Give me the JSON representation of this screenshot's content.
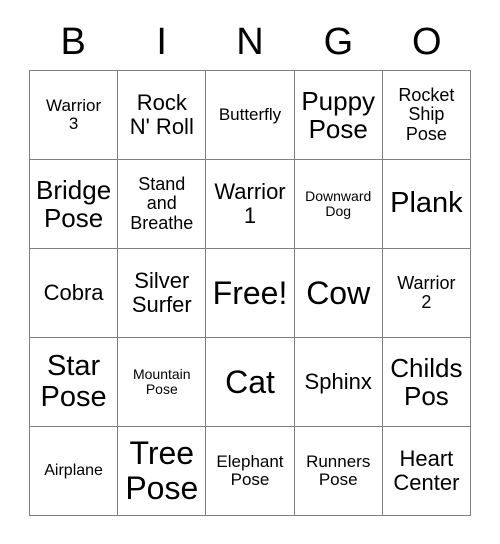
{
  "card": {
    "title": "BINGO",
    "header_letters": [
      "B",
      "I",
      "N",
      "G",
      "O"
    ],
    "grid_size": "5x5",
    "border_color": "#808080",
    "text_color": "#000000",
    "background_color": "#ffffff",
    "rows": [
      [
        {
          "text": "Warrior\n3",
          "size": "sm"
        },
        {
          "text": "Rock\nN' Roll",
          "size": "l"
        },
        {
          "text": "Butterfly",
          "size": "sm"
        },
        {
          "text": "Puppy\nPose",
          "size": "xl"
        },
        {
          "text": "Rocket\nShip\nPose",
          "size": "m"
        }
      ],
      [
        {
          "text": "Bridge\nPose",
          "size": "xl"
        },
        {
          "text": "Stand\nand\nBreathe",
          "size": "m"
        },
        {
          "text": "Warrior\n1",
          "size": "l"
        },
        {
          "text": "Downward\nDog",
          "size": "xs"
        },
        {
          "text": "Plank",
          "size": "xxl"
        }
      ],
      [
        {
          "text": "Cobra",
          "size": "l"
        },
        {
          "text": "Silver\nSurfer",
          "size": "l"
        },
        {
          "text": "Free!",
          "size": "3xl"
        },
        {
          "text": "Cow",
          "size": "3xl"
        },
        {
          "text": "Warrior\n2",
          "size": "m"
        }
      ],
      [
        {
          "text": "Star\nPose",
          "size": "xxl"
        },
        {
          "text": "Mountain\nPose",
          "size": "xs"
        },
        {
          "text": "Cat",
          "size": "3xl"
        },
        {
          "text": "Sphinx",
          "size": "l"
        },
        {
          "text": "Childs\nPos",
          "size": "xl"
        }
      ],
      [
        {
          "text": "Airplane",
          "size": "s"
        },
        {
          "text": "Tree\nPose",
          "size": "3xl"
        },
        {
          "text": "Elephant\nPose",
          "size": "sm"
        },
        {
          "text": "Runners\nPose",
          "size": "sm"
        },
        {
          "text": "Heart\nCenter",
          "size": "l"
        }
      ]
    ]
  }
}
